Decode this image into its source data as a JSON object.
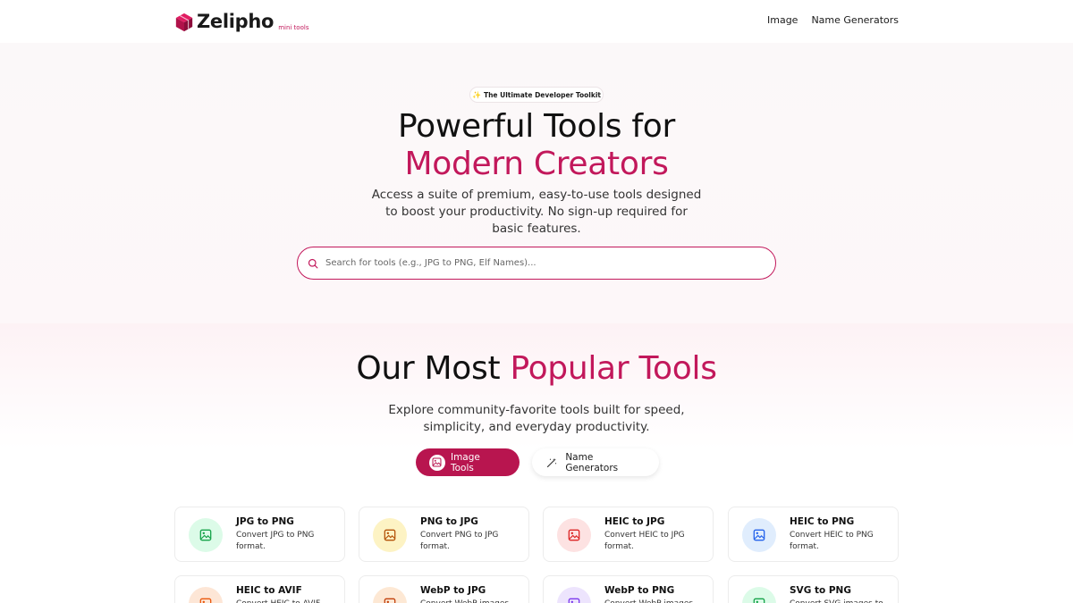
{
  "header": {
    "logo_text": "Zelipho",
    "logo_sub": "mini tools",
    "nav": [
      "Image",
      "Name Generators"
    ]
  },
  "hero": {
    "badge": "The Ultimate Developer Toolkit",
    "title_line1": "Powerful Tools for",
    "title_line2": "Modern Creators",
    "subtitle": "Access a suite of premium, easy-to-use tools designed to boost your productivity. No sign-up required for basic features.",
    "search_placeholder": "Search for tools (e.g., JPG to PNG, Elf Names)..."
  },
  "popular": {
    "title_plain": "Our Most ",
    "title_accent": "Popular Tools",
    "subtitle": "Explore community-favorite tools built for speed, simplicity, and everyday productivity.",
    "tabs": [
      {
        "label": "Image Tools",
        "active": true
      },
      {
        "label": "Name Generators",
        "active": false
      }
    ],
    "cards": [
      {
        "title": "JPG to PNG",
        "desc": "Convert JPG to PNG format.",
        "bg": "#dcfbe8",
        "fg": "#16a34a"
      },
      {
        "title": "PNG to JPG",
        "desc": "Convert PNG to JPG format.",
        "bg": "#fdf3c4",
        "fg": "#b45309"
      },
      {
        "title": "HEIC to JPG",
        "desc": "Convert HEIC to JPG format.",
        "bg": "#fde2e2",
        "fg": "#dc2626"
      },
      {
        "title": "HEIC to PNG",
        "desc": "Convert HEIC to PNG format.",
        "bg": "#e0edfd",
        "fg": "#2563eb"
      },
      {
        "title": "HEIC to AVIF",
        "desc": "Convert HEIC to AVIF",
        "bg": "#fde6d6",
        "fg": "#ea580c"
      },
      {
        "title": "WebP to JPG",
        "desc": "Convert WebP images",
        "bg": "#fde8d4",
        "fg": "#c2410c"
      },
      {
        "title": "WebP to PNG",
        "desc": "Convert WebP images",
        "bg": "#ede4fd",
        "fg": "#7c3aed"
      },
      {
        "title": "SVG to PNG",
        "desc": "Convert SVG images to",
        "bg": "#dcfbe8",
        "fg": "#16a34a"
      }
    ]
  },
  "colors": {
    "accent": "#c2185b",
    "tab_active": "#b8154f"
  }
}
